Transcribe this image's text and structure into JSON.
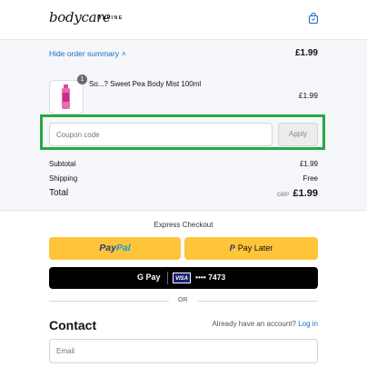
{
  "brand": {
    "name": "bodycare",
    "sub": "ONLINE"
  },
  "summary": {
    "toggle_label": "Hide order summary",
    "total": "£1.99",
    "item": {
      "quantity": "1",
      "name": "So...? Sweet Pea Body Mist 100ml",
      "price": "£1.99"
    },
    "coupon": {
      "placeholder": "Coupon code",
      "apply_label": "Apply"
    },
    "subtotal_label": "Subtotal",
    "subtotal_value": "£1.99",
    "shipping_label": "Shipping",
    "shipping_value": "Free",
    "total_label": "Total",
    "currency": "GBP",
    "total_value": "£1.99"
  },
  "express": {
    "title": "Express Checkout",
    "paypal_part1": "Pay",
    "paypal_part2": "Pal",
    "paylater_label": "Pay Later",
    "gpay_label": "G Pay",
    "visa_label": "VISA",
    "card_label": "•••• 7473",
    "or_label": "OR"
  },
  "contact": {
    "title": "Contact",
    "account_prompt": "Already have an account?",
    "login_label": "Log in",
    "email_placeholder": "Email"
  },
  "colors": {
    "accent": "#1a6bc4",
    "paypal_yellow": "#ffc439",
    "highlight": "#27a844"
  }
}
